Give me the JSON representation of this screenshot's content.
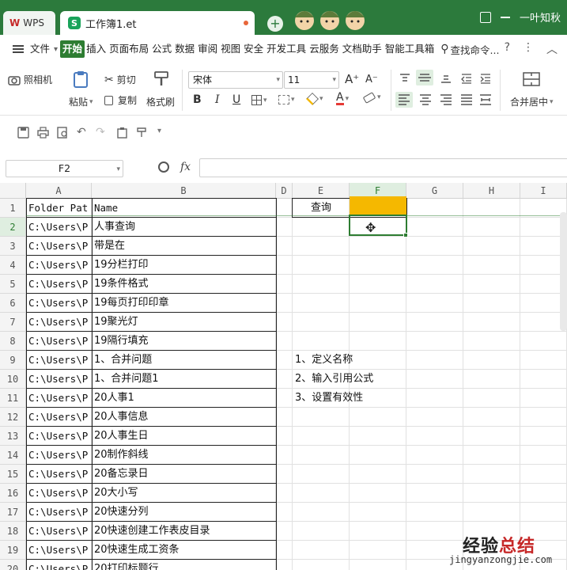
{
  "titlebar": {
    "home_tab": "WPS",
    "doc_tab": "工作簿1.et",
    "doc_icon": "S",
    "new_tab": "+",
    "user_name": "一叶知秋"
  },
  "menu": {
    "file": "文件",
    "items": [
      "开始",
      "插入",
      "页面布局",
      "公式",
      "数据",
      "审阅",
      "视图",
      "安全",
      "开发工具",
      "云服务",
      "文档助手",
      "智能工具箱"
    ],
    "search": "查找命令...",
    "help": "?",
    "more": "⋮",
    "collapse": "︿"
  },
  "ribbon": {
    "camera": "照相机",
    "paste": "粘贴",
    "cut": "剪切",
    "copy": "复制",
    "format_painter": "格式刷",
    "font_name": "宋体",
    "font_size": "11",
    "bold": "B",
    "italic": "I",
    "underline": "U",
    "merge_center": "合并居中"
  },
  "formula": {
    "cell_ref": "F2",
    "fx": "fx",
    "value": ""
  },
  "columns": [
    "A",
    "B",
    "D",
    "E",
    "F",
    "G",
    "H",
    "I"
  ],
  "selected_column": "F",
  "rows": [
    "1",
    "2",
    "3",
    "4",
    "5",
    "6",
    "7",
    "8",
    "9",
    "10",
    "11",
    "12",
    "13",
    "14",
    "15",
    "16",
    "17",
    "18",
    "19",
    "20"
  ],
  "selected_row": "2",
  "col_a": [
    "Folder Pat",
    "C:\\Users\\P",
    "C:\\Users\\P",
    "C:\\Users\\P",
    "C:\\Users\\P",
    "C:\\Users\\P",
    "C:\\Users\\P",
    "C:\\Users\\P",
    "C:\\Users\\P",
    "C:\\Users\\P",
    "C:\\Users\\P",
    "C:\\Users\\P",
    "C:\\Users\\P",
    "C:\\Users\\P",
    "C:\\Users\\P",
    "C:\\Users\\P",
    "C:\\Users\\P",
    "C:\\Users\\P",
    "C:\\Users\\P",
    "C:\\Users\\P"
  ],
  "col_b": [
    "Name",
    "人事查询",
    "带是在",
    "19分栏打印",
    "19条件格式",
    "19每页打印印章",
    "19聚光灯",
    "19隔行填充",
    "1、合并问题",
    "1、合并问题1",
    "20人事1",
    "20人事信息",
    "20人事生日",
    "20制作斜线",
    "20备忘录日",
    "20大小写",
    "20快速分列",
    "20快速创建工作表皮目录",
    "20快速生成工资条",
    "20打印标题行"
  ],
  "e1": "查询",
  "notes": [
    "1、定义名称",
    "2、输入引用公式",
    "3、设置有效性"
  ],
  "accent_color": "#2e7d32",
  "highlight_color": "#f5b800",
  "watermark": {
    "text_a": "经验",
    "text_b": "总结",
    "url": "jingyanzongjie.com"
  }
}
